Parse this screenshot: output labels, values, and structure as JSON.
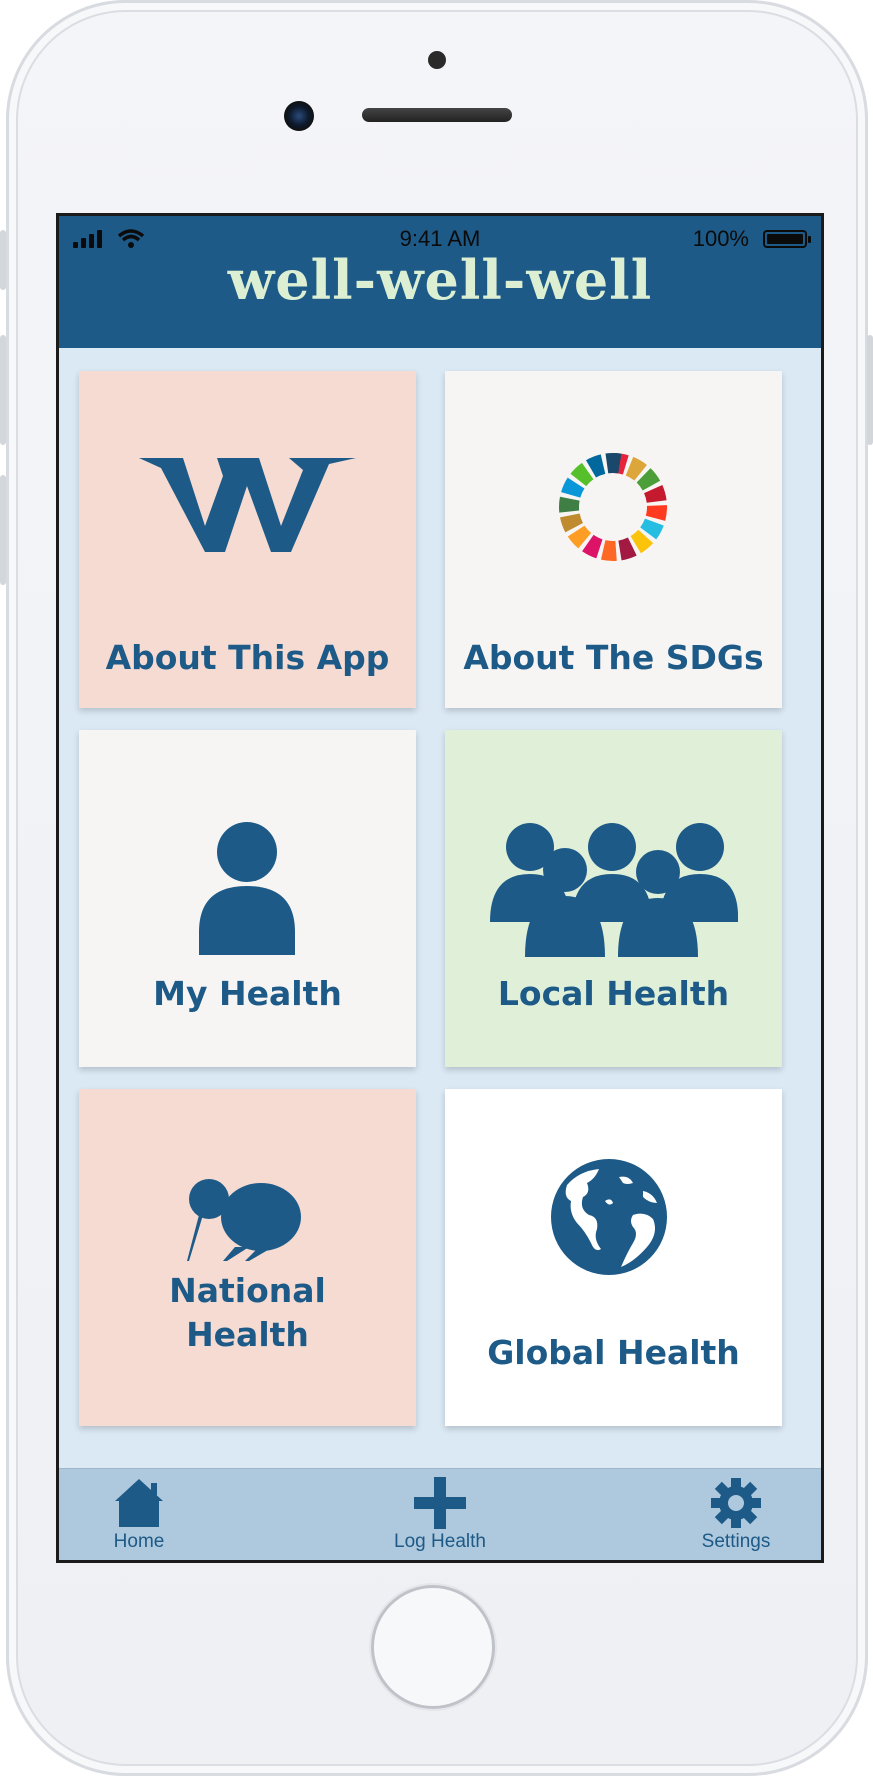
{
  "status_bar": {
    "time": "9:41 AM",
    "battery": "100%"
  },
  "app": {
    "title": "well-well-well"
  },
  "tiles": [
    {
      "label": "About This App",
      "bg": "#f5dbd2",
      "icon": "ww-logo-icon"
    },
    {
      "label": "About The SDGs",
      "bg": "#f7f5f4",
      "icon": "sdg-wheel-icon"
    },
    {
      "label": "My Health",
      "bg": "#f7f5f4",
      "icon": "person-icon"
    },
    {
      "label": "Local Health",
      "bg": "#e0efd8",
      "icon": "group-icon"
    },
    {
      "label_line1": "National",
      "label_line2": "Health",
      "bg": "#f5dbd2",
      "icon": "kiwi-bird-icon"
    },
    {
      "label": "Global Health",
      "bg": "#ffffff",
      "icon": "globe-icon"
    }
  ],
  "tabbar": {
    "items": [
      {
        "label": "Home",
        "icon": "home-icon"
      },
      {
        "label": "Log Health",
        "icon": "plus-icon"
      },
      {
        "label": "Settings",
        "icon": "gear-icon"
      }
    ]
  },
  "colors": {
    "brand": "#1d5a87",
    "title_text": "#dcefd3",
    "content_bg": "#dbe9f5",
    "tabbar_bg": "#aec8dd"
  }
}
